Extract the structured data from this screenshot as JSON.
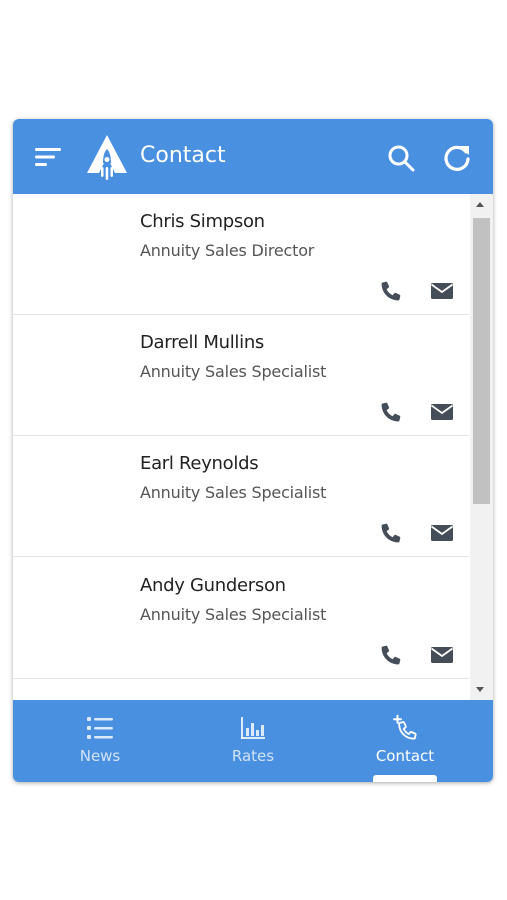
{
  "header": {
    "title": "Contact",
    "icons": [
      "menu-icon",
      "rocket-logo",
      "search-icon",
      "refresh-icon"
    ]
  },
  "contacts": [
    {
      "name": "Chris Simpson",
      "role": "Annuity Sales Director"
    },
    {
      "name": "Darrell Mullins",
      "role": "Annuity Sales Specialist"
    },
    {
      "name": "Earl Reynolds",
      "role": "Annuity Sales Specialist"
    },
    {
      "name": "Andy Gunderson",
      "role": "Annuity Sales Specialist"
    }
  ],
  "row_icons": [
    "phone-icon",
    "email-icon"
  ],
  "nav": {
    "items": [
      {
        "label": "News",
        "icon": "list-icon",
        "active": false
      },
      {
        "label": "Rates",
        "icon": "bar-chart-icon",
        "active": false
      },
      {
        "label": "Contact",
        "icon": "phone-plus-icon",
        "active": true
      }
    ]
  },
  "colors": {
    "primary": "#4a90e0",
    "text_dark": "#222222",
    "text_muted": "#555555",
    "icon_gray": "#454e58"
  }
}
